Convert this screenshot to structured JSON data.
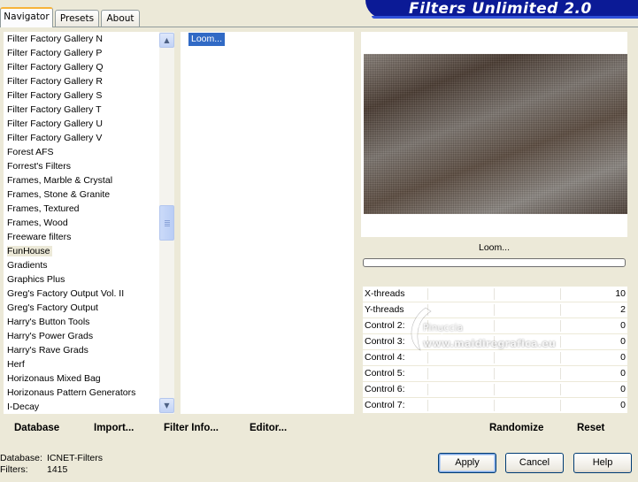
{
  "tabs": [
    {
      "label": "Navigator"
    },
    {
      "label": "Presets"
    },
    {
      "label": "About"
    }
  ],
  "banner_title": "Filters Unlimited 2.0",
  "categories": [
    "Filter Factory Gallery N",
    "Filter Factory Gallery P",
    "Filter Factory Gallery Q",
    "Filter Factory Gallery R",
    "Filter Factory Gallery S",
    "Filter Factory Gallery T",
    "Filter Factory Gallery U",
    "Filter Factory Gallery V",
    "Forest AFS",
    "Forrest's Filters",
    "Frames, Marble & Crystal",
    "Frames, Stone & Granite",
    "Frames, Textured",
    "Frames, Wood",
    "Freeware filters",
    "FunHouse",
    "Gradients",
    "Graphics Plus",
    "Greg's Factory Output Vol. II",
    "Greg's Factory Output",
    "Harry's Button Tools",
    "Harry's Power Grads",
    "Harry's Rave Grads",
    "Herf",
    "Horizonaus Mixed Bag",
    "Horizonaus Pattern Generators",
    "I-Decay"
  ],
  "selected_category": "FunHouse",
  "filters": [
    "Loom..."
  ],
  "current_filter": "Loom...",
  "params": [
    {
      "label": "X-threads",
      "value": "10"
    },
    {
      "label": "Y-threads",
      "value": "2"
    },
    {
      "label": "Control 2:",
      "value": "0"
    },
    {
      "label": "Control 3:",
      "value": "0"
    },
    {
      "label": "Control 4:",
      "value": "0"
    },
    {
      "label": "Control 5:",
      "value": "0"
    },
    {
      "label": "Control 6:",
      "value": "0"
    },
    {
      "label": "Control 7:",
      "value": "0"
    }
  ],
  "watermark": {
    "line1": "Pinuccia",
    "line2": "www.maidiregrafica.eu"
  },
  "buttons": {
    "database": "Database",
    "import": "Import...",
    "filter_info": "Filter Info...",
    "editor": "Editor...",
    "randomize": "Randomize",
    "reset": "Reset",
    "apply": "Apply",
    "cancel": "Cancel",
    "help": "Help"
  },
  "status": {
    "database_label": "Database:",
    "database_value": "ICNET-Filters",
    "filters_label": "Filters:",
    "filters_value": "1415"
  }
}
